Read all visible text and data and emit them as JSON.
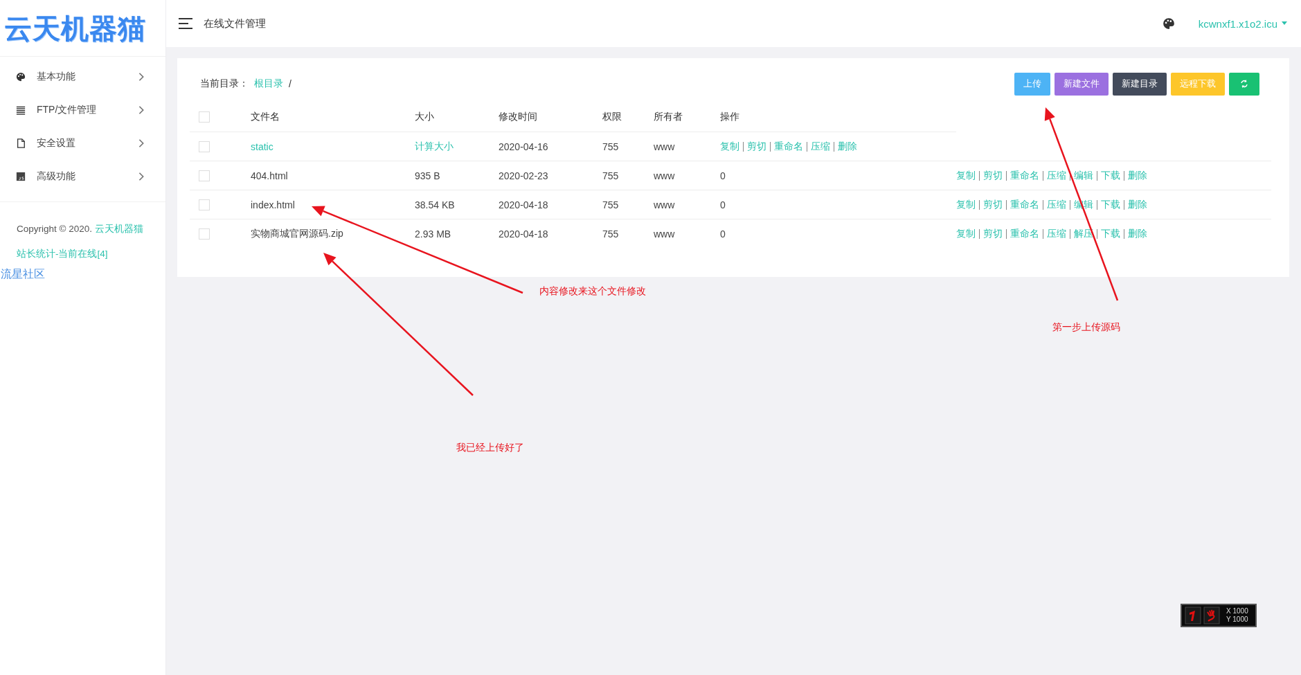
{
  "logo": {
    "text": "云天机器猫"
  },
  "sidebar": {
    "items": [
      {
        "label": "基本功能"
      },
      {
        "label": "FTP/文件管理"
      },
      {
        "label": "安全设置"
      },
      {
        "label": "高级功能"
      }
    ],
    "footer": {
      "copyright": "Copyright © 2020.",
      "site_link": "云天机器猫",
      "stats_link": "站长统计-当前在线[4]"
    },
    "community_link": "流星社区"
  },
  "header": {
    "title": "在线文件管理",
    "user": "kcwnxf1.x1o2.icu"
  },
  "breadcrumb": {
    "label": "当前目录：",
    "root": "根目录",
    "separator": "/"
  },
  "toolbar": [
    {
      "kind": "text",
      "label": "上传",
      "color": "#4db3f5"
    },
    {
      "kind": "text",
      "label": "新建文件",
      "color": "#9b70e0"
    },
    {
      "kind": "text",
      "label": "新建目录",
      "color": "#434b5b"
    },
    {
      "kind": "text",
      "label": "远程下载",
      "color": "#fdc62a"
    },
    {
      "kind": "icon",
      "color": "#19c173"
    }
  ],
  "table": {
    "header_checked": false,
    "columns": [
      "文件名",
      "大小",
      "修改时间",
      "权限",
      "所有者",
      "操作"
    ],
    "rows": [
      {
        "kind": "folder",
        "checked": false,
        "name": "static",
        "size": "计算大小",
        "modified": "2020-04-16",
        "permission": "755",
        "owner": "www",
        "operation_actions": [
          "复制",
          "剪切",
          "重命名",
          "压缩",
          "删除"
        ]
      },
      {
        "kind": "file",
        "checked": false,
        "name": "404.html",
        "size": "935 B",
        "modified": "2020-02-23",
        "permission": "755",
        "owner": "www",
        "operation_value": "0",
        "column_8": [
          "复制",
          "剪切",
          "重命名",
          "压缩",
          "编辑",
          "下载",
          "删除"
        ]
      },
      {
        "kind": "file",
        "checked": false,
        "name": "index.html",
        "size": "38.54 KB",
        "modified": "2020-04-18",
        "permission": "755",
        "owner": "www",
        "operation_value": "0",
        "column_8": [
          "复制",
          "剪切",
          "重命名",
          "压缩",
          "编辑",
          "下载",
          "删除"
        ]
      },
      {
        "kind": "file",
        "checked": false,
        "name": "实物商城官网源码.zip",
        "size": "2.93 MB",
        "modified": "2020-04-18",
        "permission": "755",
        "owner": "www",
        "operation_value": "0",
        "column_8": [
          "复制",
          "剪切",
          "重命名",
          "压缩",
          "解压",
          "下载",
          "删除"
        ]
      }
    ]
  },
  "annotations": [
    "内容修改来这个文件修改",
    "我已经上传好了",
    "第一步上传源码"
  ],
  "coordinate_widget": {
    "x": "X 1000",
    "y": "Y 1000"
  }
}
